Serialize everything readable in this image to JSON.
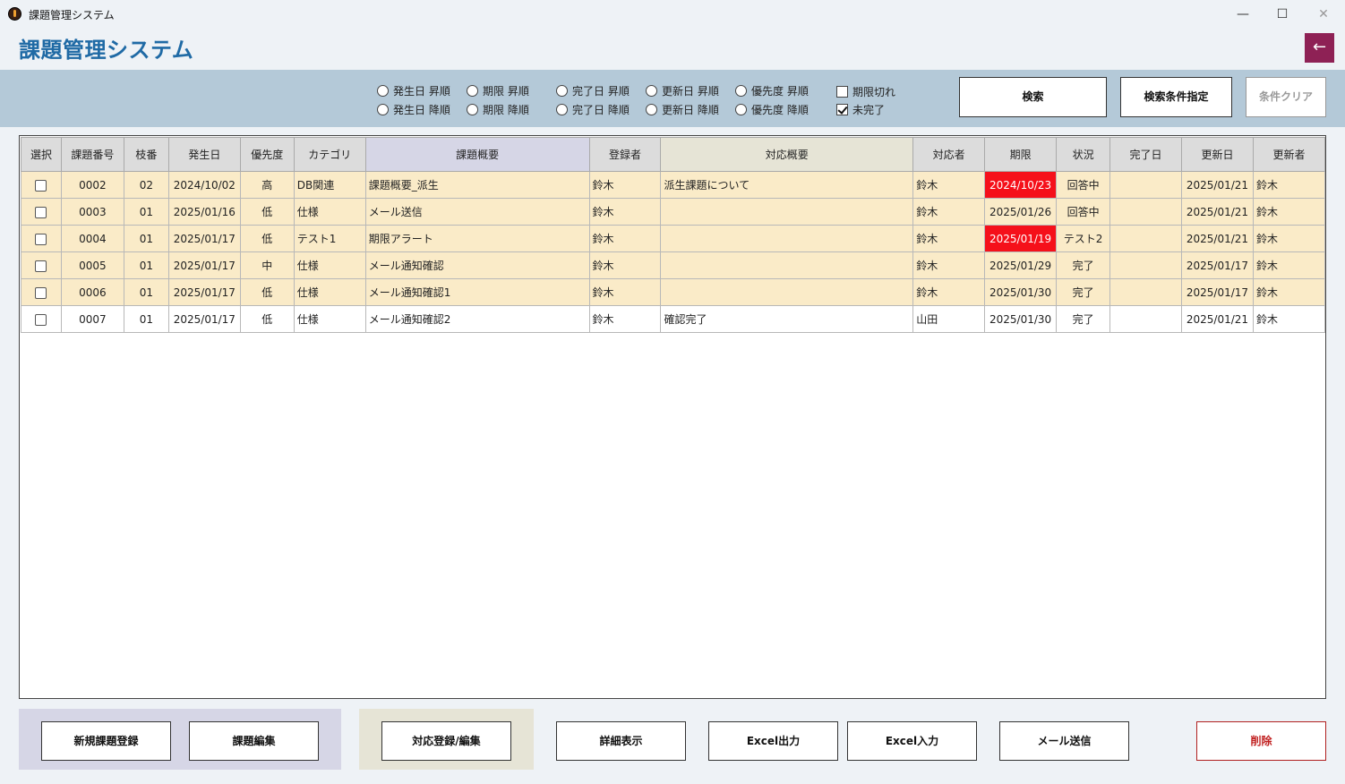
{
  "window": {
    "title": "課題管理システム",
    "min": "—",
    "max": "☐",
    "close": "✕"
  },
  "header": {
    "title": "課題管理システム",
    "back_icon": "←"
  },
  "sort_options": [
    {
      "asc": "発生日 昇順",
      "desc": "発生日 降順"
    },
    {
      "asc": "期限 昇順",
      "desc": "期限 降順"
    },
    {
      "asc": "完了日 昇順",
      "desc": "完了日 降順"
    },
    {
      "asc": "更新日 昇順",
      "desc": "更新日 降順"
    },
    {
      "asc": "優先度 昇順",
      "desc": "優先度 降順"
    }
  ],
  "filters": {
    "overdue_label": "期限切れ",
    "overdue_checked": false,
    "incomplete_label": "未完了",
    "incomplete_checked": true
  },
  "buttons": {
    "search": "検索",
    "search_conditions": "検索条件指定",
    "clear": "条件クリア"
  },
  "table": {
    "headers": [
      "選択",
      "課題番号",
      "枝番",
      "発生日",
      "優先度",
      "カテゴリ",
      "課題概要",
      "登録者",
      "対応概要",
      "対応者",
      "期限",
      "状況",
      "完了日",
      "更新日",
      "更新者"
    ],
    "rows": [
      {
        "selected": false,
        "no": "0002",
        "branch": "02",
        "date": "2024/10/02",
        "priority": "高",
        "category": "DB関連",
        "summary": "課題概要_派生",
        "registrant": "鈴木",
        "response": "派生課題について",
        "assignee": "鈴木",
        "due": "2024/10/23",
        "overdue": true,
        "status": "回答中",
        "completed": "",
        "updated": "2025/01/21",
        "updater": "鈴木",
        "highlight": true
      },
      {
        "selected": false,
        "no": "0003",
        "branch": "01",
        "date": "2025/01/16",
        "priority": "低",
        "category": "仕様",
        "summary": "メール送信",
        "registrant": "鈴木",
        "response": "",
        "assignee": "鈴木",
        "due": "2025/01/26",
        "overdue": false,
        "status": "回答中",
        "completed": "",
        "updated": "2025/01/21",
        "updater": "鈴木",
        "highlight": true
      },
      {
        "selected": false,
        "no": "0004",
        "branch": "01",
        "date": "2025/01/17",
        "priority": "低",
        "category": "テスト1",
        "summary": "期限アラート",
        "registrant": "鈴木",
        "response": "",
        "assignee": "鈴木",
        "due": "2025/01/19",
        "overdue": true,
        "status": "テスト2",
        "completed": "",
        "updated": "2025/01/21",
        "updater": "鈴木",
        "highlight": true
      },
      {
        "selected": false,
        "no": "0005",
        "branch": "01",
        "date": "2025/01/17",
        "priority": "中",
        "category": "仕様",
        "summary": "メール通知確認",
        "registrant": "鈴木",
        "response": "",
        "assignee": "鈴木",
        "due": "2025/01/29",
        "overdue": false,
        "status": "完了",
        "completed": "",
        "updated": "2025/01/17",
        "updater": "鈴木",
        "highlight": true
      },
      {
        "selected": false,
        "no": "0006",
        "branch": "01",
        "date": "2025/01/17",
        "priority": "低",
        "category": "仕様",
        "summary": "メール通知確認1",
        "registrant": "鈴木",
        "response": "",
        "assignee": "鈴木",
        "due": "2025/01/30",
        "overdue": false,
        "status": "完了",
        "completed": "",
        "updated": "2025/01/17",
        "updater": "鈴木",
        "highlight": true
      },
      {
        "selected": false,
        "no": "0007",
        "branch": "01",
        "date": "2025/01/17",
        "priority": "低",
        "category": "仕様",
        "summary": "メール通知確認2",
        "registrant": "鈴木",
        "response": "確認完了",
        "assignee": "山田",
        "due": "2025/01/30",
        "overdue": false,
        "status": "完了",
        "completed": "",
        "updated": "2025/01/21",
        "updater": "鈴木",
        "highlight": false
      }
    ]
  },
  "bottom": {
    "new_issue": "新規課題登録",
    "edit_issue": "課題編集",
    "response_edit": "対応登録/編集",
    "details": "詳細表示",
    "excel_out": "Excel出力",
    "excel_in": "Excel入力",
    "mail": "メール送信",
    "delete": "削除"
  },
  "colors": {
    "title": "#1f6aa5",
    "back": "#8e2155",
    "overdue": "#f5101a",
    "row_highlight": "#faebc8",
    "filterbar": "#b4c9d8"
  }
}
